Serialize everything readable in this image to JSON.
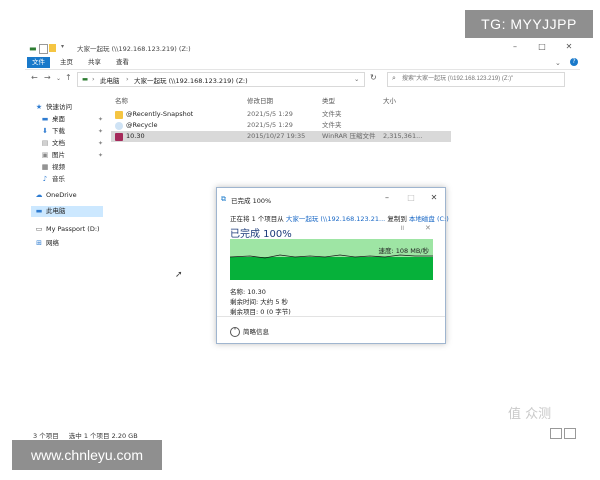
{
  "watermarks": {
    "tg": "TG: MYYJJPP",
    "site": "www.chnleyu.com",
    "brand": "值 众测"
  },
  "window": {
    "title": "大家一起玩 (\\\\192.168.123.219) (Z:)"
  },
  "ribbon": {
    "tabs": [
      "文件",
      "主页",
      "共享",
      "查看"
    ],
    "help": "?"
  },
  "address": {
    "crumbs": [
      "此电脑",
      "大家一起玩 (\\\\192.168.123.219) (Z:)"
    ],
    "search_placeholder": "搜索\"大家一起玩 (\\\\192.168.123.219) (Z:)\""
  },
  "sidebar": {
    "quick_access": "快速访问",
    "items": [
      {
        "label": "桌面",
        "icon": "desktop-icon"
      },
      {
        "label": "下载",
        "icon": "download-icon"
      },
      {
        "label": "文档",
        "icon": "document-icon"
      },
      {
        "label": "图片",
        "icon": "picture-icon"
      },
      {
        "label": "视频",
        "icon": "video-icon"
      },
      {
        "label": "音乐",
        "icon": "music-icon"
      }
    ],
    "onedrive": "OneDrive",
    "this_pc": "此电脑",
    "passport": "My Passport (D:)",
    "network": "网络"
  },
  "columns": {
    "name": "名称",
    "date": "修改日期",
    "type": "类型",
    "size": "大小"
  },
  "files": [
    {
      "name": "@Recently-Snapshot",
      "date": "2021/5/5 1:29",
      "type": "文件夹",
      "size": ""
    },
    {
      "name": "@Recycle",
      "date": "2021/5/5 1:29",
      "type": "文件夹",
      "size": ""
    },
    {
      "name": "10.30",
      "date": "2015/10/27 19:35",
      "type": "WinRAR 压缩文件",
      "size": "2,315,361..."
    }
  ],
  "status": {
    "count": "3 个项目",
    "selected": "选中 1 个项目  2.20 GB"
  },
  "dialog": {
    "title": "已完成 100%",
    "line_prefix": "正在将 1 个项目从",
    "source": "大家一起玩 (\\\\192.168.123.21...",
    "copy_to": "复制到",
    "dest": "本地磁盘 (C:)",
    "big": "已完成 100%",
    "speed": "速度: 108 MB/秒",
    "progress": 1.0,
    "name": "名称: 10.30",
    "time_left": "剩余时间: 大约 5 秒",
    "items_left": "剩余项目: 0 (0 字节)",
    "less": "简略信息"
  },
  "colors": {
    "accent": "#1979ca",
    "graph_fill": "#06b13a",
    "graph_top": "#9ee5a4"
  }
}
